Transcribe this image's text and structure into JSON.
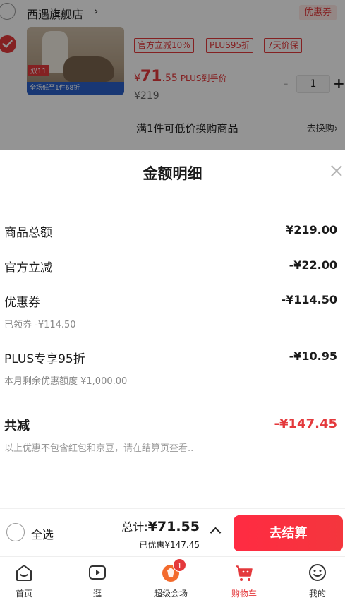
{
  "cart": {
    "shop_name": "西遇旗舰店",
    "shop_arrow": "›",
    "coupon_tag": "优惠券",
    "item": {
      "thumb_badge": "双11",
      "thumb_strip": "全场低至1件68折",
      "tags": [
        "官方立减10%",
        "PLUS95折",
        "7天价保"
      ],
      "price_currency": "¥",
      "price_integer": "71",
      "price_decimal": ".55",
      "price_note": "PLUS到手价",
      "original_price": "¥219",
      "quantity": "1",
      "minus": "-",
      "plus": "+"
    },
    "swap_text": "满1件可低价换购商品",
    "swap_link": "去换购›"
  },
  "sheet": {
    "title": "金额明细",
    "rows": [
      {
        "label": "商品总额",
        "value": "¥219.00"
      },
      {
        "label": "官方立减",
        "value": "-¥22.00"
      },
      {
        "label": "优惠券",
        "value": "-¥114.50",
        "sub": "已领券 -¥114.50"
      },
      {
        "label": "PLUS专享95折",
        "value": "-¥10.95",
        "sub": "本月剩余优惠额度 ¥1,000.00"
      }
    ],
    "total_label": "共减",
    "total_value": "-¥147.45",
    "note": "以上优惠不包含红包和京豆，请在结算页查看.."
  },
  "checkout": {
    "select_all": "全选",
    "sum_label": "总计:",
    "sum_value": "¥71.55",
    "saved": "已优惠¥147.45",
    "button": "去结算"
  },
  "tabbar": {
    "items": [
      {
        "label": "首页",
        "icon": "home-icon"
      },
      {
        "label": "逛",
        "icon": "play-icon"
      },
      {
        "label": "超级会场",
        "icon": "super-venue-icon",
        "badge": "1"
      },
      {
        "label": "购物车",
        "icon": "cart-icon"
      },
      {
        "label": "我的",
        "icon": "smile-icon"
      }
    ],
    "active_index": 3
  },
  "colors": {
    "accent": "#e4393c",
    "checkout_button": "#f4363d",
    "overlay": "rgba(0,0,0,0.42)"
  }
}
